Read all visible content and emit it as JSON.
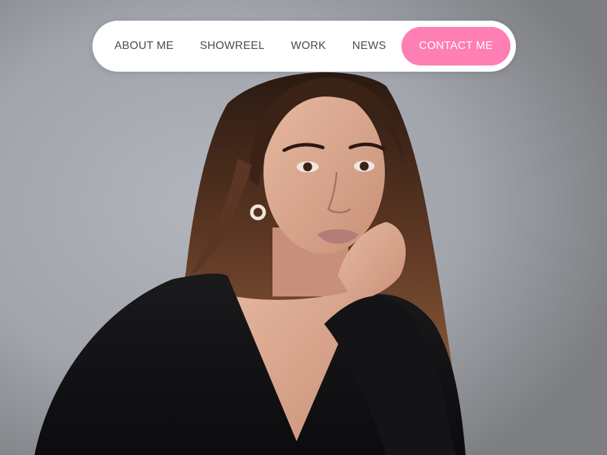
{
  "nav": {
    "links": {
      "about": "ABOUT ME",
      "showreel": "SHOWREEL",
      "work": "WORK",
      "news": "NEWS"
    },
    "cta_label": "CONTACT ME"
  },
  "colors": {
    "accent": "#ff7eb3",
    "nav_text": "#4a4a4a",
    "nav_bg": "#ffffff",
    "backdrop": "#a2a5ab",
    "top": "#0f0e10",
    "hair": "#3d2416",
    "skin": "#d9a78f"
  },
  "hero": {
    "image": "portrait-photo"
  }
}
